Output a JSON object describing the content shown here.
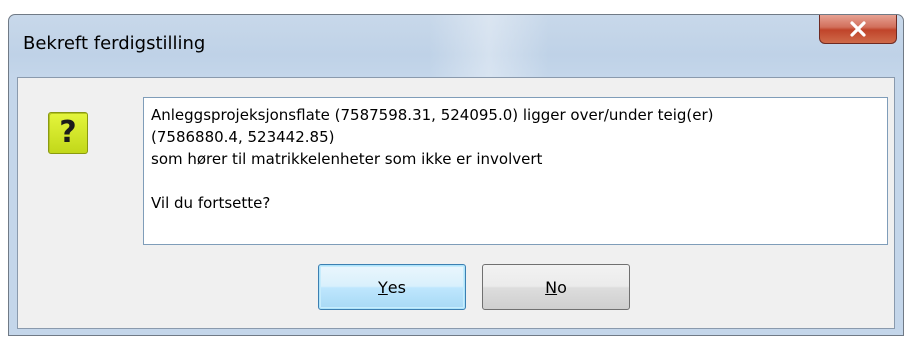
{
  "window": {
    "title": "Bekreft ferdigstilling",
    "close_icon": "close-icon"
  },
  "dialog": {
    "icon": "question-icon",
    "icon_glyph": "?",
    "message_lines": [
      "Anleggsprojeksjonsflate (7587598.31, 524095.0) ligger over/under teig(er)",
      "(7586880.4, 523442.85)",
      "som hører til matrikkelenheter som ikke er involvert",
      "",
      "Vil du fortsette?"
    ]
  },
  "buttons": {
    "yes": {
      "mnemonic": "Y",
      "rest": "es"
    },
    "no": {
      "mnemonic": "N",
      "rest": "o"
    }
  },
  "colors": {
    "close_button": "#c7452c",
    "question_icon": "#d2e82a",
    "default_button_border": "#3c7fb1"
  }
}
